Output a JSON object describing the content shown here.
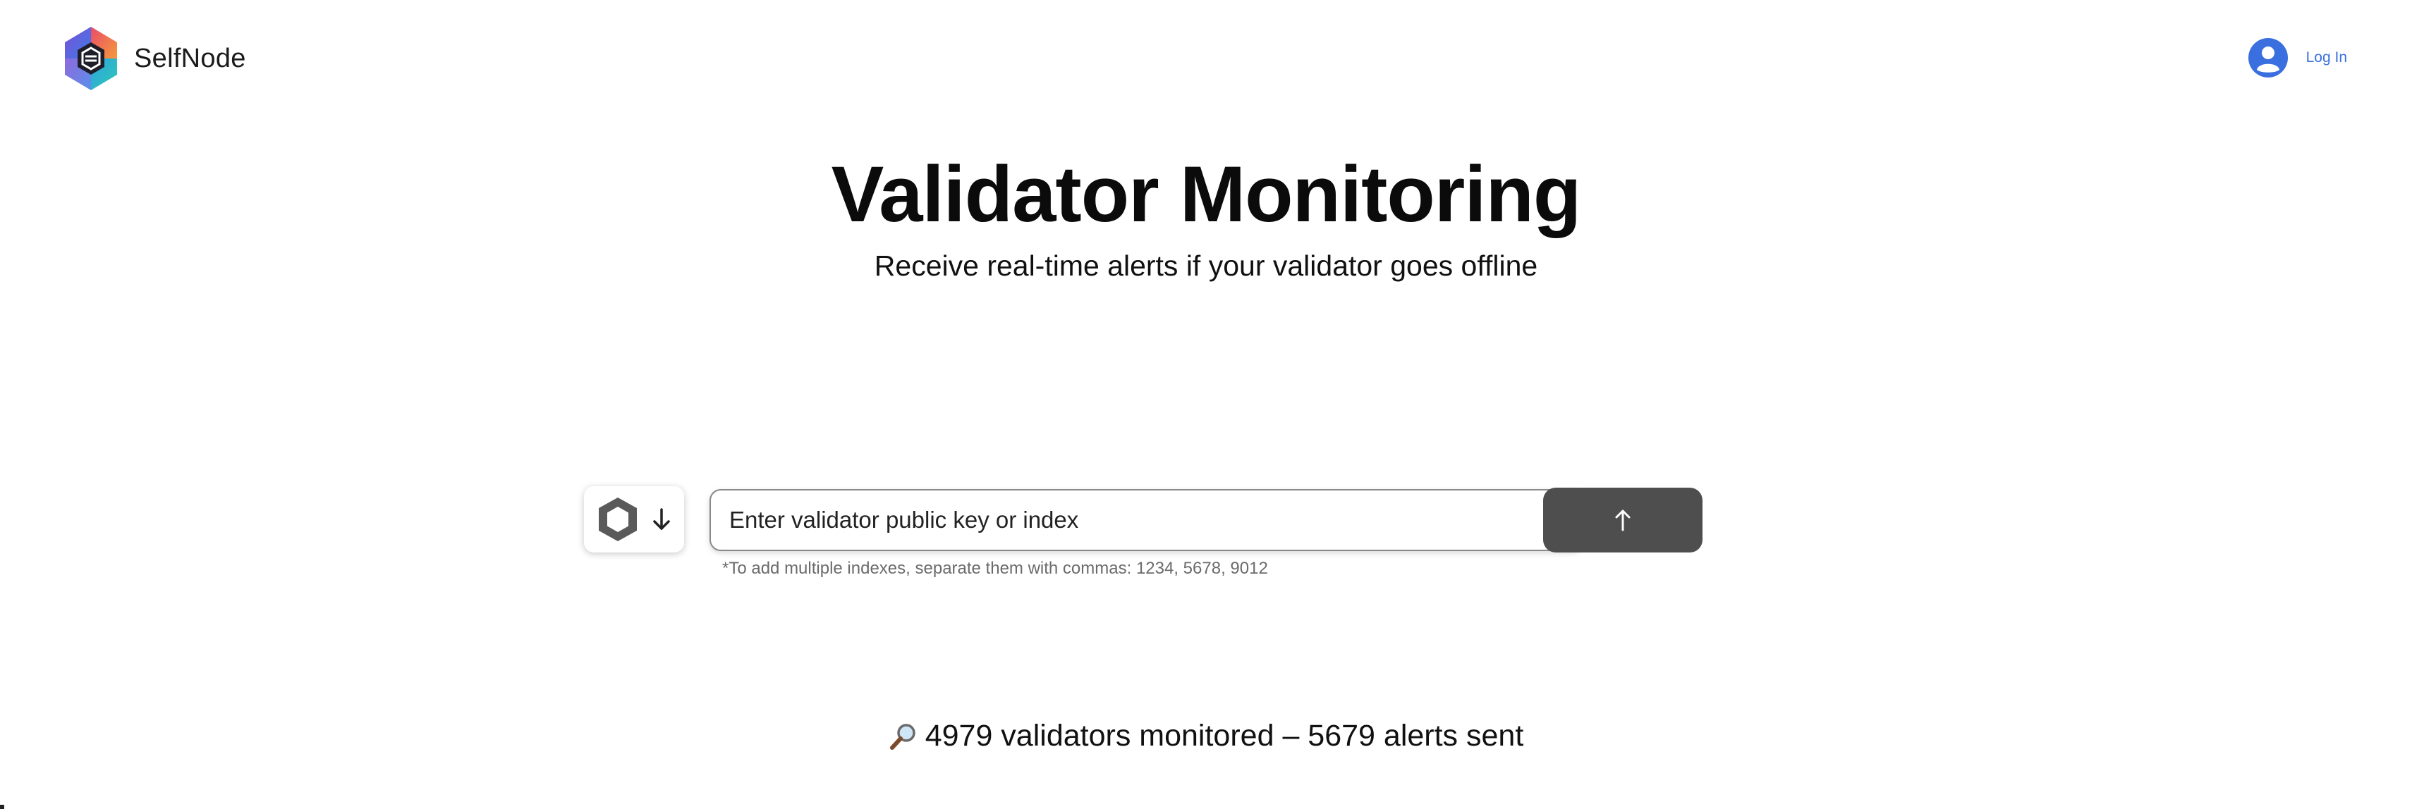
{
  "header": {
    "brand_name": "SelfNode",
    "brand_logo_icon": "selfnode-hexagon-logo-icon",
    "login_label": "Log In",
    "login_icon": "user-avatar-icon",
    "accent_color": "#3A6FE0"
  },
  "hero": {
    "title": "Validator Monitoring",
    "subtitle": "Receive real-time alerts if your validator goes offline"
  },
  "search": {
    "chain_icon": "hexagon-chain-icon",
    "chain_dropdown_icon": "arrow-down-icon",
    "placeholder": "Enter validator public key or index",
    "value": "",
    "submit_icon": "arrow-up-icon",
    "submit_color": "#4e4e4e",
    "hint": "*To add multiple indexes, separate them with commas: 1234, 5678, 9012"
  },
  "stats": {
    "icon": "magnifying-glass-icon",
    "text": "4979 validators monitored – 5679 alerts sent"
  }
}
